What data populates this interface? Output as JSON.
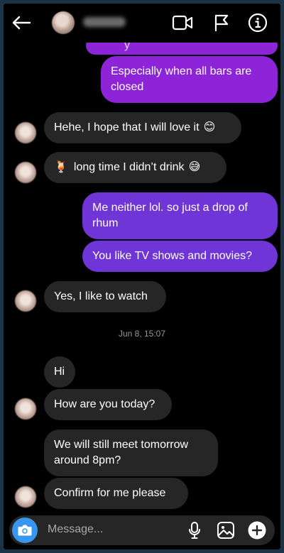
{
  "header": {
    "back_icon": "arrow-left-icon",
    "video_icon": "video-camera-icon",
    "flag_icon": "flag-icon",
    "info_icon": "info-icon"
  },
  "messages": {
    "m0": "y",
    "m1": "Especially when all bars are closed",
    "m2": "Hehe, I hope that I will love it",
    "m2_emoji": "😊",
    "m3_emoji": "🍹",
    "m3": "long time I didn’t drink",
    "m3_emoji2": "😅",
    "m4": "Me neither lol. so just a drop of rhum",
    "m5": "You like TV shows and movies?",
    "m6": "Yes, I like to watch",
    "timestamp": "Jun 8, 15:07",
    "m7": "Hi",
    "m8": "How are you today?",
    "m9": "We will still meet tomorrow around 8pm?",
    "m10": "Confirm for me please"
  },
  "composer": {
    "placeholder": "Message...",
    "camera_icon": "camera-icon",
    "mic_icon": "microphone-icon",
    "gallery_icon": "image-icon",
    "add_icon": "plus-icon"
  },
  "colors": {
    "incoming": "#262626",
    "outgoing_purple": "#8e24d8",
    "outgoing_violet": "#6f35d6",
    "accent_blue": "#3797f0"
  }
}
